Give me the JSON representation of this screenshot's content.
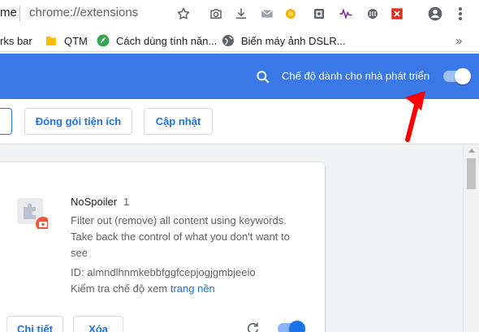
{
  "omnibox": {
    "partial_label": "me",
    "url": "chrome://extensions",
    "icons": [
      "star-icon",
      "camera-icon",
      "download-icon",
      "email-icon",
      "coin-icon",
      "photo-icon",
      "wave-icon",
      "web-icon",
      "close-box-icon",
      "account-icon",
      "more-icon"
    ]
  },
  "bookmarks": {
    "items": [
      {
        "label": "rks bar",
        "icon": "none"
      },
      {
        "label": "QTM",
        "icon": "folder-icon"
      },
      {
        "label": "Cách dùng tính năn...",
        "icon": "leaf-icon"
      },
      {
        "label": "Biến máy ảnh DSLR...",
        "icon": "globe-icon"
      }
    ],
    "overflow_label": "»"
  },
  "header": {
    "dev_mode_label": "Chế độ dành cho nhà phát triển",
    "dev_mode_on": true
  },
  "toolbar": {
    "pack_label": "Đóng gói tiện ích",
    "update_label": "Cập nhật"
  },
  "extension": {
    "name": "NoSpoiler",
    "version": "1",
    "description": "Filter out (remove) all content using keywords. Take back the control of what you don't want to see",
    "id_text": "ID: almndlhnmkebbfggfcepjogjgmbjeeio",
    "inspect_prefix": "Kiểm tra chế độ xem",
    "inspect_link": "trang nền",
    "details_label": "Chi tiết",
    "remove_label": "Xóa",
    "enabled": true
  },
  "colors": {
    "header_blue": "#3b78e7",
    "link_blue": "#1a73e8",
    "arrow_red": "#ff0000"
  }
}
